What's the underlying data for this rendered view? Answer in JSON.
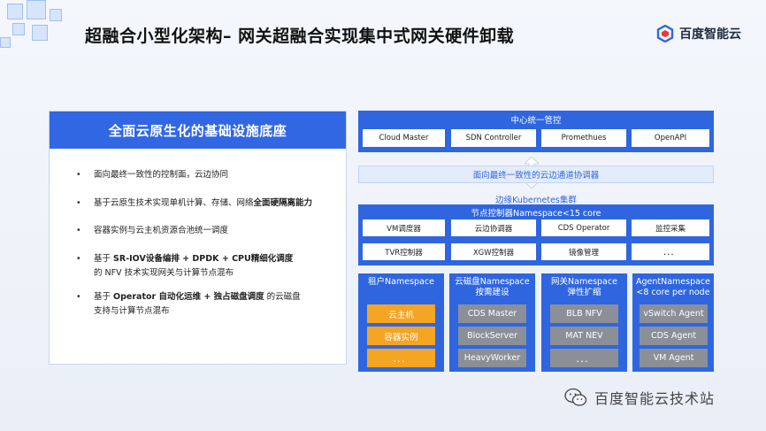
{
  "title": "超融合小型化架构– 网关超融合实现集中式网关硬件卸载",
  "logo_text": "百度智能云",
  "left": {
    "header": "全面云原生化的基础设施底座",
    "bullets": [
      {
        "pre": "面向最终一致性的控制面，云边协同",
        "bold": "",
        "post": "",
        "line2": ""
      },
      {
        "pre": "基于云原生技术实现单机计算、存储、网络",
        "bold": "全面硬隔离能力",
        "post": "",
        "line2": ""
      },
      {
        "pre": "容器实例与云主机资源合池统一调度",
        "bold": "",
        "post": "",
        "line2": ""
      },
      {
        "pre": "基于 ",
        "bold": "SR-IOV设备编排 + DPDK + CPU精细化调度",
        "post": "",
        "line2": "的 NFV 技术实现网关与计算节点混布"
      },
      {
        "pre": "基于 ",
        "bold": "Operator 自动化运维 + 独占磁盘调度",
        "post": " 的云磁盘",
        "line2": "支持与计算节点混布"
      }
    ]
  },
  "center": {
    "title": "中心统一管控",
    "items": [
      "Cloud Master",
      "SDN Controller",
      "Promethues",
      "OpenAPI"
    ]
  },
  "band_text": "面向最终一致性的云边通道协调器",
  "k8s_label": "边缘Kubernetes集群",
  "node": {
    "title": "节点控制器Namespace<15 core",
    "row1": [
      "VM调度器",
      "云边协调器",
      "CDS Operator",
      "监控采集"
    ],
    "row2": [
      "TVR控制器",
      "XGW控制器",
      "镜像管理",
      "．．．"
    ]
  },
  "namespaces": [
    {
      "title1": "租户Namespace",
      "title2": "",
      "style": "orange",
      "items": [
        "云主机",
        "容器实例",
        "．．．"
      ]
    },
    {
      "title1": "云磁盘Namespace",
      "title2": "按需建设",
      "style": "gray",
      "items": [
        "CDS Master",
        "BlockServer",
        "HeavyWorker"
      ]
    },
    {
      "title1": "网关Namespace",
      "title2": "弹性扩缩",
      "style": "gray",
      "items": [
        "BLB NFV",
        "MAT NEV",
        "．．．"
      ]
    },
    {
      "title1": "AgentNamespace",
      "title2": "<8 core per node",
      "style": "gray",
      "items": [
        "vSwitch Agent",
        "CDS Agent",
        "VM Agent"
      ]
    }
  ],
  "footer_text": "百度智能云技术站",
  "colors": {
    "accent": "#2f66e0",
    "orange": "#f5a524",
    "gray": "#8a8f98"
  }
}
